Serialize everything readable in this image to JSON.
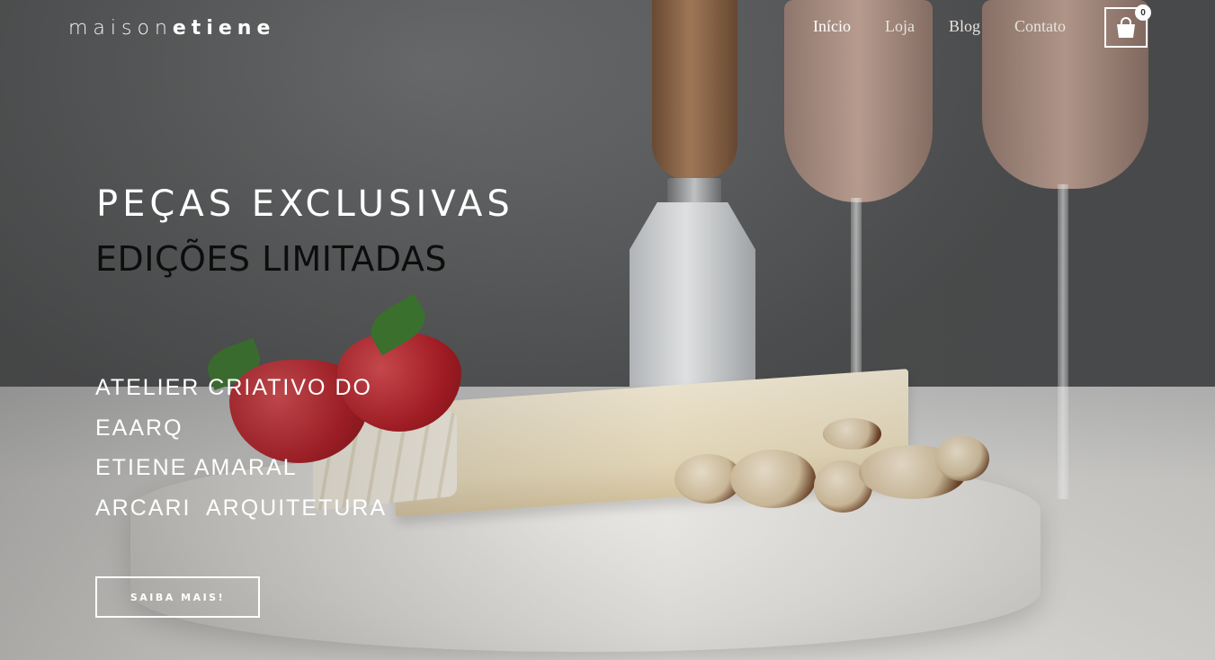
{
  "header": {
    "logo": {
      "part1": "maison",
      "part2": "etiene"
    },
    "nav": [
      {
        "label": "Início",
        "active": true
      },
      {
        "label": "Loja"
      },
      {
        "label": "Blog"
      },
      {
        "label": "Contato"
      }
    ],
    "cart": {
      "icon": "shopping-bag-icon",
      "count": "0"
    }
  },
  "hero": {
    "headline": "PEÇAS EXCLUSIVAS",
    "subheadline": "EDIÇÕES LIMITADAS",
    "tagline": [
      "ATELIER CRIATIVO DO",
      "EAARQ",
      "ETIENE AMARAL",
      "ARCARI  ARQUITETURA"
    ],
    "cta_label": "SAIBA MAIS!"
  },
  "colors": {
    "text_light": "#ffffff",
    "text_dark": "#0d0d0d",
    "nav_text": "#e8e3dc"
  }
}
